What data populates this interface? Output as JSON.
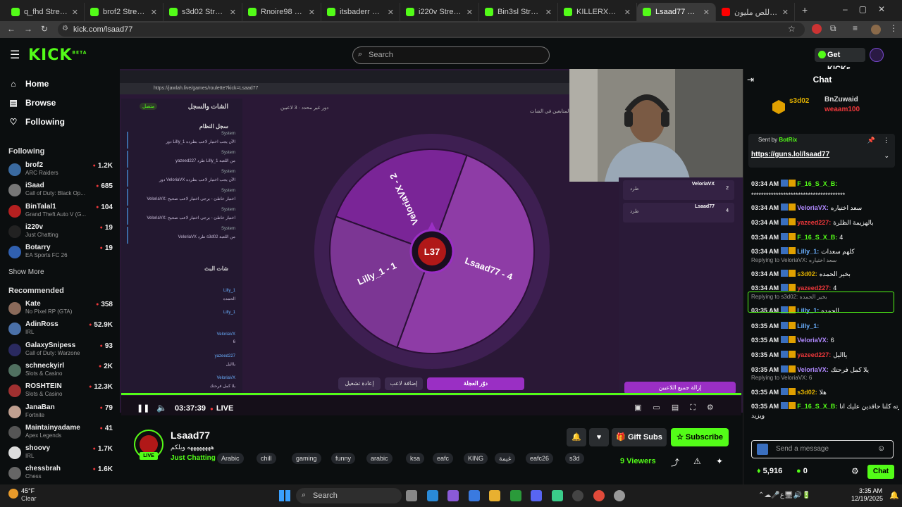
{
  "browser": {
    "tabs": [
      {
        "label": "q_fhd Stream - Wa",
        "color": "#53fc18"
      },
      {
        "label": "brof2 Stream - Wa",
        "color": "#53fc18"
      },
      {
        "label": "s3d02 Stream - W",
        "color": "#53fc18"
      },
      {
        "label": "Rnoire98 Stream",
        "color": "#53fc18"
      },
      {
        "label": "itsbaderr Stream",
        "color": "#53fc18"
      },
      {
        "label": "i220v Stream - Wa",
        "color": "#53fc18"
      },
      {
        "label": "Bin3sl Stream - W",
        "color": "#53fc18"
      },
      {
        "label": "KILLERX8 Stream",
        "color": "#53fc18"
      },
      {
        "label": "Lsaad77 Stream -",
        "color": "#53fc18"
      },
      {
        "label": "تحدي اللص مليون",
        "color": "#ff0000"
      }
    ],
    "active_tab": 8,
    "url": "kick.com/lsaad77"
  },
  "header": {
    "logo": "KICK",
    "logo_sup": "BETA",
    "search_placeholder": "Search",
    "get_kicks": "Get KICKs"
  },
  "sidebar": {
    "nav": [
      {
        "label": "Home",
        "icon": "home-icon"
      },
      {
        "label": "Browse",
        "icon": "browse-icon"
      },
      {
        "label": "Following",
        "icon": "heart-icon"
      }
    ],
    "following_title": "Following",
    "following": [
      {
        "name": "brof2",
        "category": "ARC Raiders",
        "viewers": "1.2K",
        "color": "#3a6aa0"
      },
      {
        "name": "iSaad",
        "category": "Call of Duty: Black Op...",
        "viewers": "685",
        "color": "#777"
      },
      {
        "name": "BinTalal1",
        "category": "Grand Theft Auto V (G...",
        "viewers": "104",
        "color": "#b52020"
      },
      {
        "name": "i220v",
        "category": "Just Chatting",
        "viewers": "19",
        "color": "#222"
      },
      {
        "name": "Botarry",
        "category": "EA Sports FC 26",
        "viewers": "19",
        "color": "#3060b0"
      }
    ],
    "show_more": "Show More",
    "recommended_title": "Recommended",
    "recommended": [
      {
        "name": "Kate",
        "category": "No Pixel RP (GTA)",
        "viewers": "358",
        "color": "#8a6a5a"
      },
      {
        "name": "AdinRoss",
        "category": "IRL",
        "viewers": "52.9K",
        "color": "#4a70a8"
      },
      {
        "name": "GalaxySnipess",
        "category": "Call of Duty: Warzone",
        "viewers": "93",
        "color": "#2a2a60"
      },
      {
        "name": "schneckyirl",
        "category": "Slots & Casino",
        "viewers": "2K",
        "color": "#507060"
      },
      {
        "name": "ROSHTEIN",
        "category": "Slots & Casino",
        "viewers": "12.3K",
        "color": "#a03030"
      },
      {
        "name": "JanaBan",
        "category": "Fortnite",
        "viewers": "79",
        "color": "#c0a090"
      },
      {
        "name": "Maintainyadame",
        "category": "Apex Legends",
        "viewers": "41",
        "color": "#555"
      },
      {
        "name": "shoovy",
        "category": "IRL",
        "viewers": "1.7K",
        "color": "#ddd"
      },
      {
        "name": "chessbrah",
        "category": "Chess",
        "viewers": "1.6K",
        "color": "#666"
      }
    ]
  },
  "embed": {
    "url": "https://jawlah.live/games/roulette?kick=Lsaad77",
    "left_title": "الشات والسجل",
    "online": "متصل",
    "system_log": "سجل النظام",
    "live_chat": "شات البث",
    "status_left": "دور غير محدد",
    "players_count": "3 لاعبين",
    "followers_label": "المتابعين في الشات",
    "wheel_segments": [
      {
        "label": "VeloriaVX - 2",
        "color": "#7a2597"
      },
      {
        "label": "Lsaad77 - 4",
        "color": "#8e3ca6"
      },
      {
        "label": "Lilly_1 - 1",
        "color": "#7c3694"
      }
    ],
    "wheel_logo": "L37",
    "btn_restart": "إعادة تشغيل",
    "btn_add": "إضافة لاعب",
    "btn_spin": "دوّر العجلة",
    "btn_remove_all": "إزالة جميع اللاعبين",
    "player_rows": [
      {
        "name": "VeloriaVX",
        "num": "2",
        "action": "طرد"
      },
      {
        "name": "Lsaad77",
        "num": "4",
        "action": "طرد"
      }
    ],
    "log_msgs": [
      {
        "user": "System",
        "text": "دور Lilly_1 الآن يجب اختيار لاعب بطرده"
      },
      {
        "user": "System",
        "text": "yazeed227 طرد Lilly_1 من اللعبة"
      },
      {
        "user": "System",
        "text": "دور VeloriaVX الآن يجب اختيار لاعب بطرده"
      },
      {
        "user": "System",
        "text": "VeloriaVX: اختيار خاطئ - يرجى اختيار لاعب صحيح"
      },
      {
        "user": "System",
        "text": "VeloriaVX: اختيار خاطئ - يرجى اختيار لاعب صحيح"
      },
      {
        "user": "System",
        "text": "VeloriaVX طرد s3d02 من اللعبة"
      }
    ],
    "chat_msgs": [
      {
        "user": "Lilly_1",
        "text": "الحمده"
      },
      {
        "user": "Lilly_1",
        "text": ""
      },
      {
        "user": "VeloriaVX",
        "text": "6"
      },
      {
        "user": "yazeed227",
        "text": "يااليل"
      },
      {
        "user": "VeloriaVX",
        "text": "يلا كمل فرحتك"
      }
    ]
  },
  "player": {
    "time": "03:37:39",
    "live": "LIVE"
  },
  "stream": {
    "name": "Lsaad77",
    "title": "ههههههههه ويلكم",
    "category": "Just Chatting",
    "live_badge": "LIVE",
    "tags": [
      "Arabic",
      "chill",
      "gaming",
      "funny",
      "arabic",
      "ksa",
      "eafc",
      "KING",
      "غيمة",
      "eafc26",
      "s3d"
    ],
    "gift_subs": "Gift Subs",
    "subscribe": "Subscribe",
    "viewers": "9 Viewers"
  },
  "chat": {
    "title": "Chat",
    "top_gifters": [
      {
        "name": "s3d02",
        "rank": "1"
      },
      {
        "name": "BnZuwaid",
        "rank": "1"
      },
      {
        "name": "weaam100",
        "rank": "1"
      }
    ],
    "pinned_sender_label": "Sent by",
    "pinned_sender": "BotRix",
    "pinned_link": "https://guns.lol/lsaad77",
    "messages": [
      {
        "time": "03:34 AM",
        "user": "F_16_S_X_B:",
        "color": "#53fc18",
        "text": ""
      },
      {
        "time": "",
        "user": "",
        "color": "#fff",
        "text": "**************************************"
      },
      {
        "time": "03:34 AM",
        "user": "VeloriaVX:",
        "color": "#b089ff",
        "text": "سعد اختياره"
      },
      {
        "time": "03:34 AM",
        "user": "yazeed227:",
        "color": "#f0383b",
        "text": "بالهزيمة الظلرة"
      },
      {
        "time": "03:34 AM",
        "user": "F_16_S_X_B:",
        "color": "#53fc18",
        "text": "4"
      },
      {
        "time": "03:34 AM",
        "user": "Lilly_1:",
        "color": "#6ab0ff",
        "text": "كلهم سعدات"
      },
      {
        "time": "03:34 AM",
        "user": "s3d02:",
        "color": "#e0b000",
        "text": "بخير الحمده"
      },
      {
        "time": "03:34 AM",
        "user": "yazeed227:",
        "color": "#f0383b",
        "text": "4"
      },
      {
        "time": "03:35 AM",
        "user": "Lilly_1:",
        "color": "#6ab0ff",
        "text": "الحمده"
      },
      {
        "time": "03:35 AM",
        "user": "Lilly_1:",
        "color": "#6ab0ff",
        "text": ""
      },
      {
        "time": "03:35 AM",
        "user": "VeloriaVX:",
        "color": "#b089ff",
        "text": "6"
      },
      {
        "time": "03:35 AM",
        "user": "yazeed227:",
        "color": "#f0383b",
        "text": "يااليل"
      },
      {
        "time": "03:35 AM",
        "user": "VeloriaVX:",
        "color": "#b089ff",
        "text": "يلا كمل فرحتك"
      },
      {
        "time": "03:35 AM",
        "user": "s3d02:",
        "color": "#e0b000",
        "text": "هلا"
      },
      {
        "time": "03:35 AM",
        "user": "F_16_S_X_B:",
        "color": "#53fc18",
        "text": "انا ابرزته كلنا حافدين عليك انا"
      },
      {
        "time": "",
        "user": "",
        "color": "#fff",
        "text": "ويزيد"
      }
    ],
    "replies": [
      {
        "text": "Replying to VeloriaVX: سعد اختياره"
      },
      {
        "text": "Replying to s3d02: بخير الحمده"
      },
      {
        "text": "Replying to VeloriaVX: 6"
      }
    ],
    "input_placeholder": "Send a message",
    "points": "5,916",
    "zero": "0",
    "chat_button": "Chat"
  },
  "taskbar": {
    "search": "Search",
    "weather_temp": "45°F",
    "weather_desc": "Clear",
    "time": "3:35 AM",
    "date": "12/19/2025"
  }
}
